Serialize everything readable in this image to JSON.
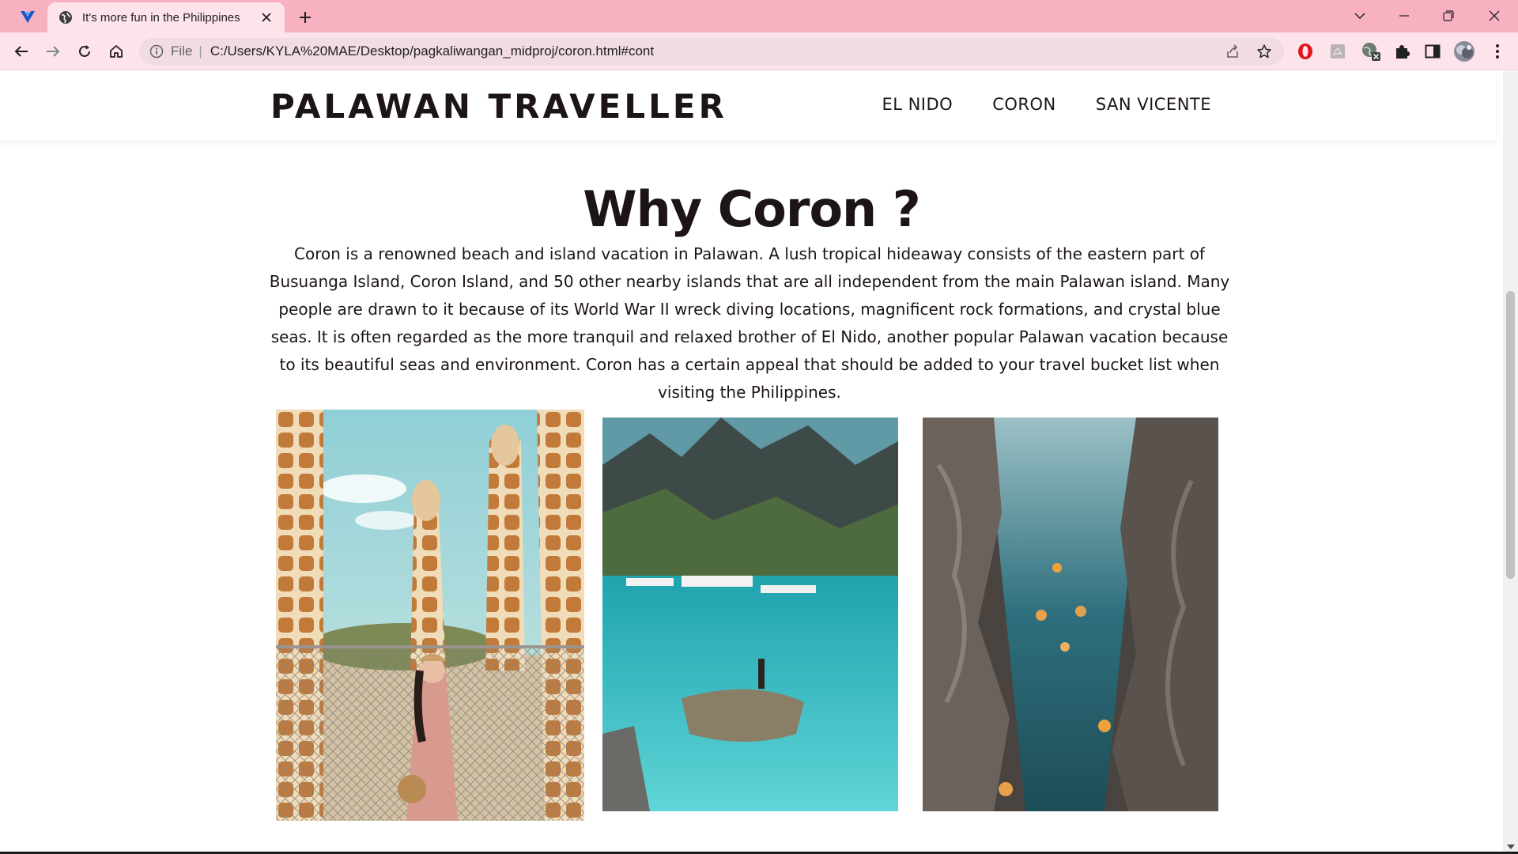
{
  "browser": {
    "tab_title": "It's more fun in the Philippines",
    "url_scheme": "File",
    "url": "C:/Users/KYLA%20MAE/Desktop/pagkaliwangan_midproj/coron.html#cont"
  },
  "site": {
    "brand": "PALAWAN TRAVELLER",
    "nav": [
      "EL NIDO",
      "CORON",
      "SAN VICENTE"
    ]
  },
  "content": {
    "title": "Why Coron ?",
    "intro": "Coron is a renowned beach and island vacation in Palawan. A lush tropical hideaway consists of the eastern part of Busuanga Island, Coron Island, and 50 other nearby islands that are all independent from the main Palawan island. Many people are drawn to it because of its World War II wreck diving locations, magnificent rock formations, and crystal blue seas. It is often regarded as the more tranquil and relaxed brother of El Nido, another popular Palawan vacation because to its beautiful seas and environment. Coron has a certain appeal that should be added to your travel bucket list when visiting the Philippines."
  },
  "icons": {
    "app_logo": "v-logo-icon",
    "favicon": "globe-icon",
    "tab_close": "close-icon",
    "new_tab": "plus-icon",
    "dropdown": "chevron-down-icon",
    "minimize": "minimize-icon",
    "restore": "restore-icon",
    "close_window": "close-icon",
    "back": "back-arrow-icon",
    "forward": "forward-arrow-icon",
    "reload": "reload-icon",
    "home": "home-icon",
    "info": "info-icon",
    "share": "share-icon",
    "bookmark": "star-icon",
    "opera_ext": "opera-icon",
    "pdf_ext": "pdf-icon",
    "web_ext": "globe-x-icon",
    "extensions": "puzzle-icon",
    "side_panel": "side-panel-icon",
    "profile": "avatar-icon",
    "menu": "kebab-menu-icon"
  },
  "colors": {
    "tab_strip": "#f8b1c0",
    "toolbar": "#fde3ea",
    "text_dark": "#1c1417"
  }
}
